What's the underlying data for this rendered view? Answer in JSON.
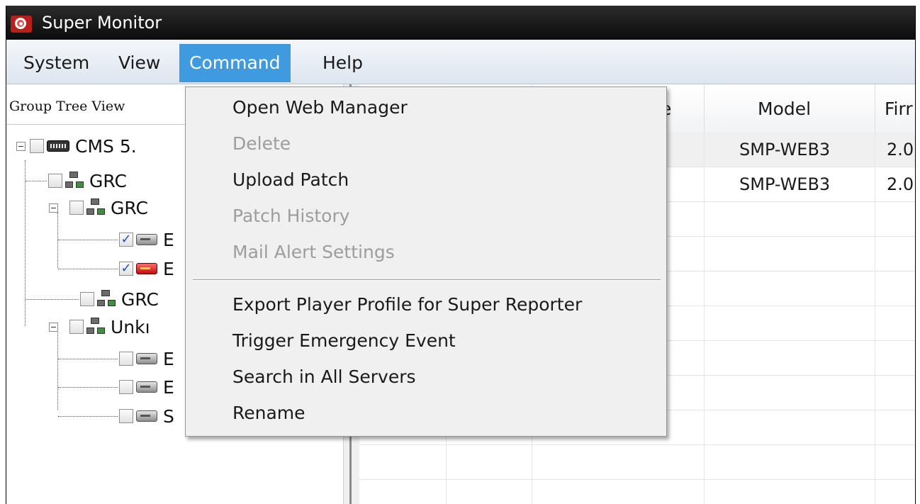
{
  "window": {
    "title": "Super Monitor"
  },
  "menubar": {
    "items": [
      {
        "label": "System"
      },
      {
        "label": "View"
      },
      {
        "label": "Command"
      },
      {
        "label": "Help"
      }
    ]
  },
  "command_menu": {
    "items": [
      {
        "label": "Open Web Manager",
        "enabled": true
      },
      {
        "label": "Delete",
        "enabled": false
      },
      {
        "label": "Upload Patch",
        "enabled": true
      },
      {
        "label": "Patch History",
        "enabled": false
      },
      {
        "label": "Mail Alert Settings",
        "enabled": false
      },
      {
        "label": "Export Player Profile for Super Reporter",
        "enabled": true
      },
      {
        "label": "Trigger Emergency Event",
        "enabled": true
      },
      {
        "label": "Search in All Servers",
        "enabled": true
      },
      {
        "label": "Rename",
        "enabled": true
      }
    ]
  },
  "tree": {
    "title": "Group Tree View",
    "nodes": [
      {
        "label": "CMS 5.",
        "icon": "cms-icon",
        "checked": false
      },
      {
        "label": "GRC",
        "icon": "group-icon",
        "checked": false
      },
      {
        "label": "GRC",
        "icon": "group-icon",
        "checked": false
      },
      {
        "label": "E",
        "icon": "server-icon",
        "checked": true
      },
      {
        "label": "E",
        "icon": "server-alert-icon",
        "checked": true
      },
      {
        "label": "GRC",
        "icon": "group-icon",
        "checked": false
      },
      {
        "label": "Unkı",
        "icon": "group-icon",
        "checked": false
      },
      {
        "label": "E",
        "icon": "server-icon",
        "checked": false
      },
      {
        "label": "E",
        "icon": "server-icon",
        "checked": false
      },
      {
        "label": "S",
        "icon": "server-icon",
        "checked": false
      }
    ]
  },
  "grid": {
    "columns": [
      "e",
      "Model",
      "Firr"
    ],
    "rows": [
      {
        "model": "SMP-WEB3",
        "firmware": "2.0"
      },
      {
        "model": "SMP-WEB3",
        "firmware": "2.0"
      }
    ]
  }
}
